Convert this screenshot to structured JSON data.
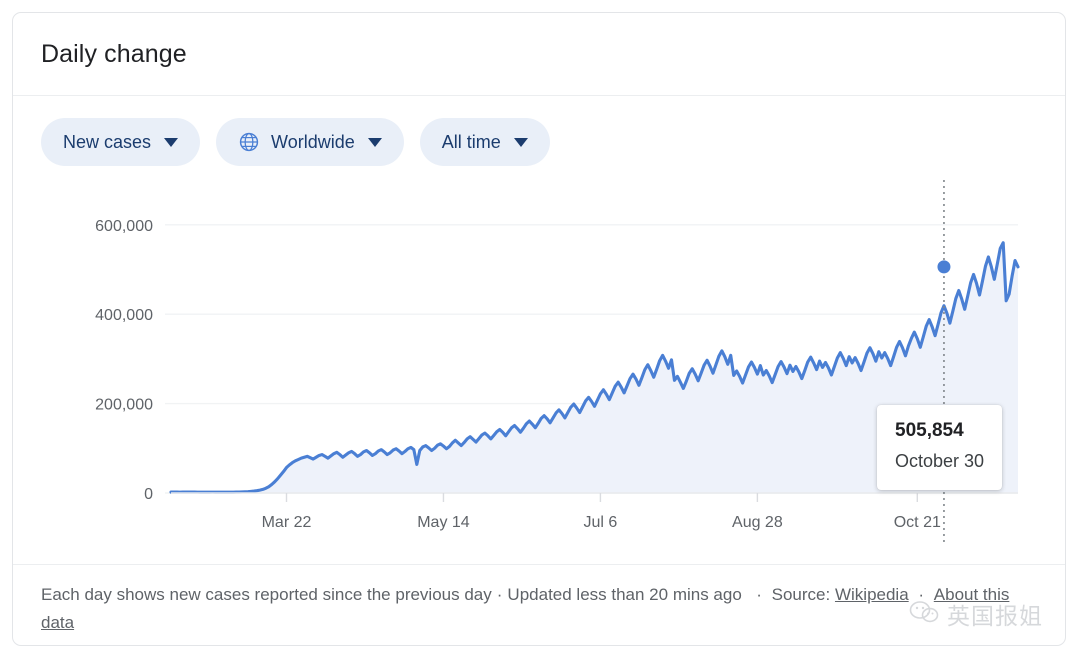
{
  "card": {
    "title": "Daily change"
  },
  "chips": [
    {
      "label": "New cases",
      "icon": "",
      "name": "metric"
    },
    {
      "label": "Worldwide",
      "icon": "globe-icon",
      "name": "region"
    },
    {
      "label": "All time",
      "icon": "",
      "name": "range"
    }
  ],
  "tooltip": {
    "value": "505,854",
    "date": "October 30"
  },
  "footer": {
    "description": "Each day shows new cases reported since the previous day",
    "updated": "Updated less than 20 mins ago",
    "source_label": "Source:",
    "source_name": "Wikipedia",
    "link": "About this data",
    "sep": "·"
  },
  "watermark": {
    "text": "英国报姐"
  },
  "colors": {
    "line": "#4a7fd4",
    "area": "#eef2fa",
    "chip_bg": "#e9eff8",
    "chip_text": "#1b3c6e",
    "grid": "#f1f3f4",
    "axis_text": "#5f6368",
    "title": "#202124"
  },
  "chart_data": {
    "type": "line",
    "title": "Daily change",
    "xlabel": "",
    "ylabel": "",
    "ylim": [
      0,
      660000
    ],
    "grid": true,
    "legend": false,
    "ytick_labels": [
      "0",
      "200,000",
      "400,000",
      "600,000"
    ],
    "ytick_values": [
      0,
      200000,
      400000,
      600000
    ],
    "xtick_labels": [
      "Mar 22",
      "May 14",
      "Jul 6",
      "Aug 28",
      "Oct 21"
    ],
    "xtick_indices": [
      39,
      92,
      145,
      198,
      252
    ],
    "series_name": "New cases",
    "x_start": "Feb 11",
    "x_end": "October 30",
    "marker_index": 261,
    "marker_value": 505854,
    "values": [
      2100,
      2050,
      2000,
      1980,
      2100,
      2200,
      2150,
      2080,
      2000,
      1950,
      1900,
      1880,
      1850,
      1900,
      1950,
      1920,
      1870,
      1800,
      1750,
      1780,
      1820,
      1900,
      2000,
      2100,
      2300,
      2600,
      3000,
      3600,
      4300,
      5200,
      6400,
      8000,
      10500,
      14000,
      19000,
      25000,
      32000,
      40000,
      48000,
      57000,
      63000,
      68000,
      72000,
      75000,
      78000,
      80000,
      82000,
      79000,
      76000,
      80000,
      84000,
      86000,
      82000,
      78000,
      83000,
      88000,
      91000,
      86000,
      80000,
      85000,
      90000,
      93000,
      88000,
      82000,
      86000,
      92000,
      95000,
      90000,
      84000,
      88000,
      94000,
      97000,
      92000,
      86000,
      90000,
      96000,
      99000,
      94000,
      88000,
      93000,
      99000,
      102000,
      97000,
      64000,
      95000,
      103000,
      106000,
      101000,
      95000,
      100000,
      107000,
      110000,
      105000,
      99000,
      104000,
      112000,
      118000,
      112000,
      106000,
      113000,
      121000,
      126000,
      120000,
      114000,
      122000,
      130000,
      134000,
      128000,
      121000,
      129000,
      137000,
      142000,
      136000,
      128000,
      137000,
      146000,
      151000,
      144000,
      136000,
      145000,
      155000,
      161000,
      154000,
      146000,
      156000,
      167000,
      173000,
      166000,
      157000,
      168000,
      179000,
      186000,
      178000,
      168000,
      180000,
      192000,
      199000,
      190000,
      180000,
      193000,
      206000,
      214000,
      205000,
      194000,
      208000,
      222000,
      231000,
      221000,
      209000,
      224000,
      239000,
      248000,
      237000,
      224000,
      240000,
      256000,
      266000,
      255000,
      241000,
      258000,
      276000,
      287000,
      274000,
      259000,
      277000,
      296000,
      308000,
      295000,
      279000,
      298000,
      252000,
      261000,
      248000,
      234000,
      250000,
      268000,
      278000,
      266000,
      251000,
      268000,
      286000,
      297000,
      284000,
      268000,
      287000,
      306000,
      318000,
      305000,
      288000,
      308000,
      263000,
      273000,
      261000,
      246000,
      264000,
      282000,
      293000,
      281000,
      266000,
      285000,
      264000,
      274000,
      262000,
      247000,
      265000,
      283000,
      294000,
      282000,
      267000,
      286000,
      272000,
      283000,
      271000,
      256000,
      274000,
      293000,
      304000,
      291000,
      276000,
      295000,
      281000,
      292000,
      280000,
      264000,
      283000,
      302000,
      314000,
      301000,
      285000,
      305000,
      291000,
      303000,
      290000,
      274000,
      293000,
      313000,
      325000,
      312000,
      295000,
      316000,
      302000,
      314000,
      301000,
      285000,
      305000,
      326000,
      339000,
      325000,
      307000,
      329000,
      346000,
      360000,
      345000,
      326000,
      349000,
      373000,
      388000,
      372000,
      352000,
      377000,
      403000,
      419000,
      402000,
      380000,
      407000,
      435000,
      453000,
      434000,
      411000,
      440000,
      470000,
      489000,
      469000,
      443000,
      474000,
      507000,
      528000,
      506000,
      478000,
      512000,
      547000,
      560000,
      430000,
      445000,
      485000,
      520000,
      505854
    ]
  }
}
